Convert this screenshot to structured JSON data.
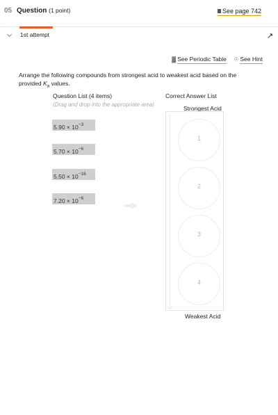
{
  "header": {
    "number": "05",
    "title": "Question",
    "points": "(1 point)",
    "see_page": "See page 742"
  },
  "attempt": {
    "label": "1st attempt"
  },
  "tools": {
    "periodic_table": "See Periodic Table",
    "hint": "See Hint"
  },
  "prompt": {
    "text_before": "Arrange the following compounds from strongest acid to weakest acid based on the provided ",
    "ka_symbol": "K",
    "ka_sub": "a",
    "text_after": " values."
  },
  "question_list": {
    "header": "Question List (4 items)",
    "instruction": "(Drag and drop into the appropriate area)",
    "items": [
      {
        "mantissa": "5.90",
        "times": "× 10",
        "exponent": "−3"
      },
      {
        "mantissa": "5.70",
        "times": "× 10",
        "exponent": "−6"
      },
      {
        "mantissa": "5.50",
        "times": "× 10",
        "exponent": "−16"
      },
      {
        "mantissa": "7.20",
        "times": "× 10",
        "exponent": "−6"
      }
    ]
  },
  "answer_list": {
    "header": "Correct Answer List",
    "top_label": "Strongest Acid",
    "bottom_label": "Weakest Acid",
    "slots": [
      "1",
      "2",
      "3",
      "4"
    ]
  },
  "icons": {
    "see_page": "book-icon",
    "periodic_table": "periodic-table-icon",
    "hint": "lightbulb-icon",
    "collapse": "chevron-down-icon",
    "pin": "pin-icon",
    "move": "arrow-right-icon"
  },
  "colors": {
    "accent": "#e2612a",
    "link_underline": "#d9a400",
    "item_bg": "#cfcfcf"
  }
}
